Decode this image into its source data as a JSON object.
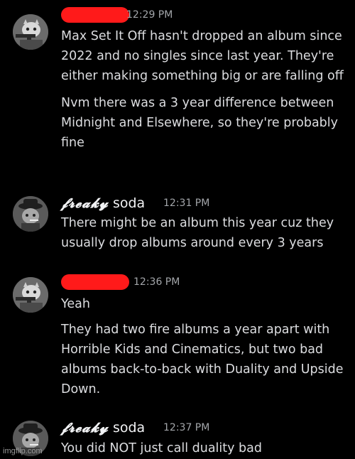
{
  "messages": [
    {
      "author_redacted": true,
      "time": "12:29 PM",
      "lines": [
        "Max Set It Off hasn't dropped an album since 2022 and no singles since last year. They're either making something big or are falling off",
        "Nvm there was a 3 year difference between Midnight and Elsewhere, so they're probably fine"
      ]
    },
    {
      "author_fancy": "𝓯𝓻𝓮𝓪𝓴𝔂",
      "author_plain": "soda",
      "time": "12:31 PM",
      "lines": [
        "There might be an album this year cuz they usually drop albums around every 3 years"
      ]
    },
    {
      "author_redacted": true,
      "time": "12:36 PM",
      "lines": [
        "Yeah",
        "They had two fire albums a year apart with Horrible Kids and Cinematics, but two bad albums back-to-back with Duality and Upside Down."
      ]
    },
    {
      "author_fancy": "𝓯𝓻𝓮𝓪𝓴𝔂",
      "author_plain": "soda",
      "time": "12:37 PM",
      "lines": [
        "You did NOT just call duality bad"
      ]
    }
  ],
  "watermark": "imgflip.com",
  "colors": {
    "background": "#000000",
    "text": "#dcdde0",
    "timestamp": "#a3a6aa",
    "redaction": "#ff1a1a"
  },
  "icons": {
    "user1_avatar": "avatar-cat-with-gun-icon",
    "user2_avatar": "avatar-cat-with-hat-icon"
  }
}
